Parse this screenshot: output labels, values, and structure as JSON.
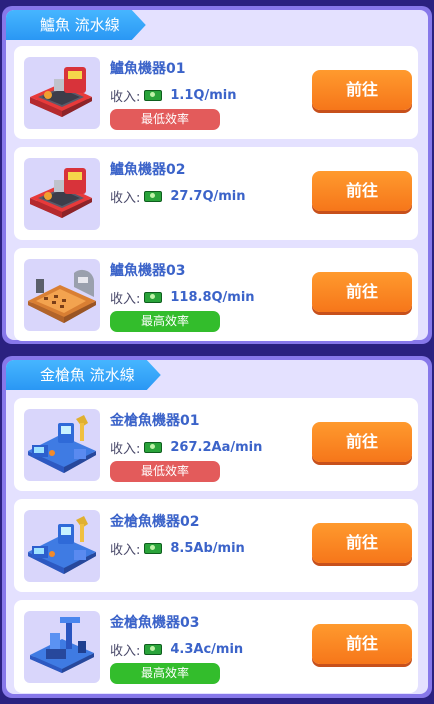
{
  "sections": [
    {
      "title": "鱸魚 流水線",
      "machines": [
        {
          "name": "鱸魚機器01",
          "income_label": "收入:",
          "income": "1.1Q/min",
          "badge": "最低效率",
          "badge_type": "low",
          "button": "前往",
          "thumb_icon": "red-fish-machine-icon"
        },
        {
          "name": "鱸魚機器02",
          "income_label": "收入:",
          "income": "27.7Q/min",
          "badge": "",
          "badge_type": "",
          "button": "前往",
          "thumb_icon": "red-fish-machine-icon"
        },
        {
          "name": "鱸魚機器03",
          "income_label": "收入:",
          "income": "118.8Q/min",
          "badge": "最高效率",
          "badge_type": "high",
          "button": "前往",
          "thumb_icon": "orange-conveyor-machine-icon"
        }
      ]
    },
    {
      "title": "金槍魚 流水線",
      "machines": [
        {
          "name": "金槍魚機器01",
          "income_label": "收入:",
          "income": "267.2Aa/min",
          "badge": "最低效率",
          "badge_type": "low",
          "button": "前往",
          "thumb_icon": "blue-robot-machine-icon"
        },
        {
          "name": "金槍魚機器02",
          "income_label": "收入:",
          "income": "8.5Ab/min",
          "badge": "",
          "badge_type": "",
          "button": "前往",
          "thumb_icon": "blue-robot-machine-icon"
        },
        {
          "name": "金槍魚機器03",
          "income_label": "收入:",
          "income": "4.3Ac/min",
          "badge": "最高效率",
          "badge_type": "high",
          "button": "前往",
          "thumb_icon": "blue-press-machine-icon"
        }
      ]
    }
  ],
  "colors": {
    "background": "#2a2180",
    "panel_border": "#8778ea",
    "panel_fill": "#e4e1ff",
    "tab_blue": "#2a97f4",
    "button_orange": "#f6761a",
    "badge_low": "#e35b5b",
    "badge_high": "#33bd2c",
    "name_blue": "#3b63c9"
  }
}
